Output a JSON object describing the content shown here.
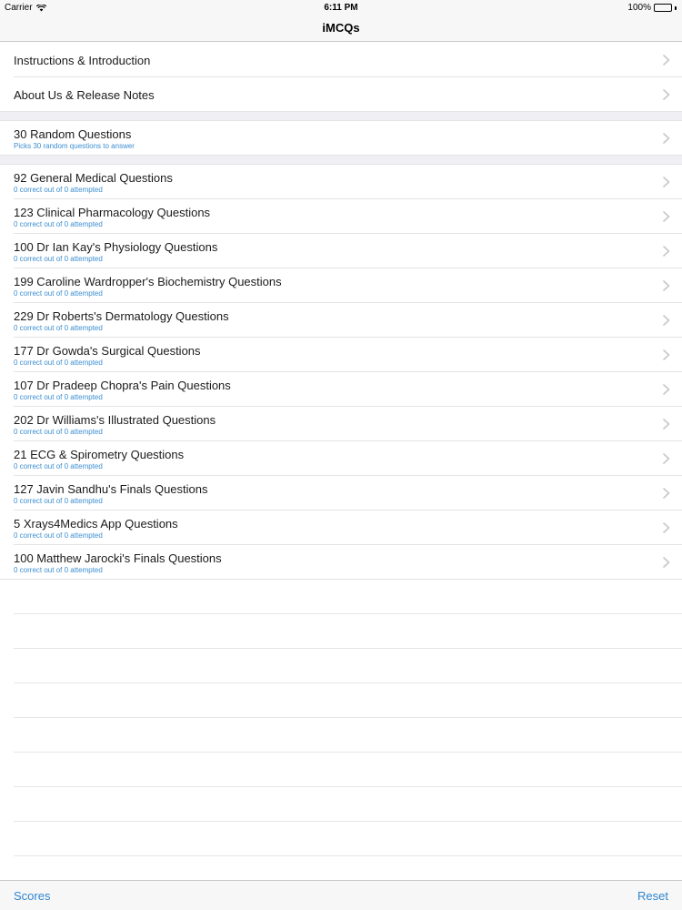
{
  "status": {
    "carrier": "Carrier",
    "time": "6:11 PM",
    "battery": "100%",
    "icons": [
      "wifi-icon",
      "battery-icon"
    ]
  },
  "nav": {
    "title": "iMCQs"
  },
  "section1": [
    {
      "title": "Instructions & Introduction"
    },
    {
      "title": "About Us & Release Notes"
    }
  ],
  "section2": [
    {
      "title": "30 Random Questions",
      "subtitle": "Picks 30 random questions to answer"
    }
  ],
  "section3": [
    {
      "title": "92 General Medical Questions",
      "subtitle": "0 correct out of 0 attempted"
    },
    {
      "title": "123 Clinical Pharmacology Questions",
      "subtitle": "0 correct out of 0 attempted"
    },
    {
      "title": "100 Dr Ian Kay's Physiology Questions",
      "subtitle": "0 correct out of 0 attempted"
    },
    {
      "title": "199 Caroline Wardropper's Biochemistry Questions",
      "subtitle": "0 correct out of 0 attempted"
    },
    {
      "title": "229 Dr Roberts's Dermatology Questions",
      "subtitle": "0 correct out of 0 attempted"
    },
    {
      "title": "177 Dr Gowda's Surgical Questions",
      "subtitle": "0 correct out of 0 attempted"
    },
    {
      "title": "107 Dr Pradeep Chopra's Pain Questions",
      "subtitle": "0 correct out of 0 attempted"
    },
    {
      "title": "202 Dr Williams's Illustrated Questions",
      "subtitle": "0 correct out of 0 attempted"
    },
    {
      "title": "21 ECG & Spirometry Questions",
      "subtitle": "0 correct out of 0 attempted"
    },
    {
      "title": "127 Javin Sandhu's Finals Questions",
      "subtitle": "0 correct out of 0 attempted"
    },
    {
      "title": "5 Xrays4Medics App Questions",
      "subtitle": "0 correct out of 0 attempted"
    },
    {
      "title": "100 Matthew Jarocki's Finals Questions",
      "subtitle": "0 correct out of 0 attempted"
    }
  ],
  "toolbar": {
    "scores_label": "Scores",
    "reset_label": "Reset"
  },
  "colors": {
    "accent": "#2f86d0",
    "subtitle": "#3b8ed1",
    "group_bg": "#efeff4",
    "bar_bg": "#f7f7f7"
  }
}
